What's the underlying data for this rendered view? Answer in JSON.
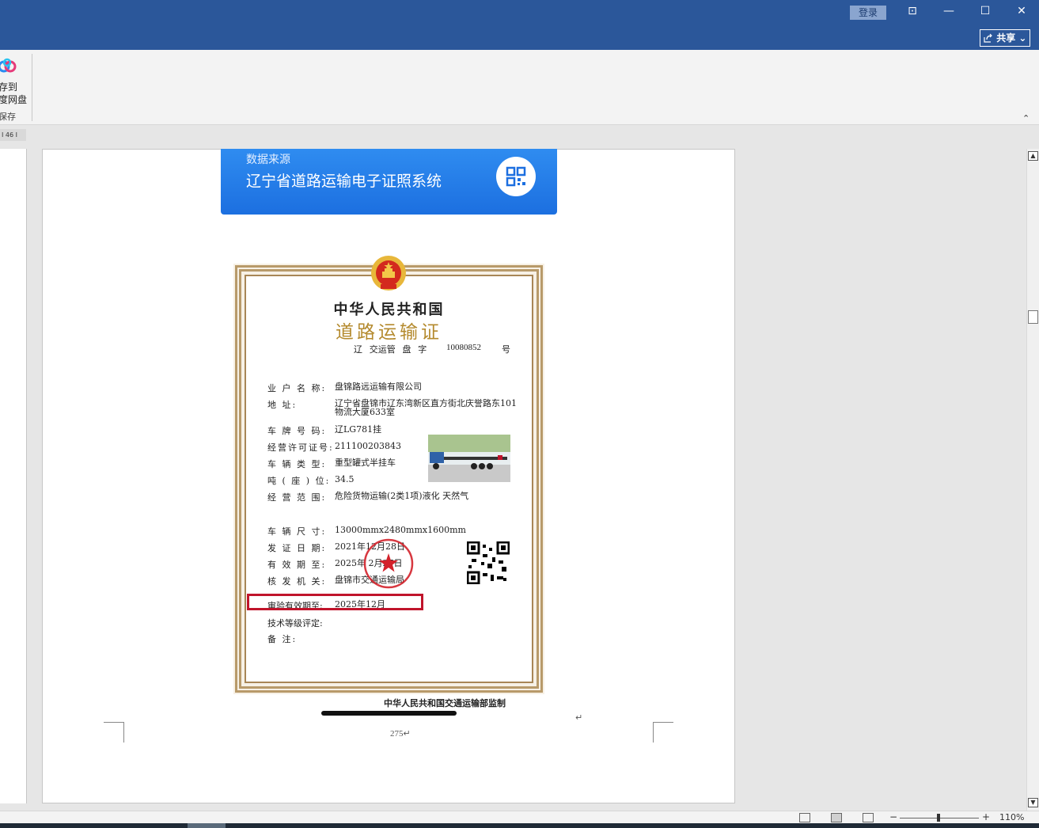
{
  "titlebar": {
    "login_label": "登录",
    "share_label": "共享",
    "share_chevron": "⌄",
    "controls": {
      "ribbon_display": "⊡",
      "minimize": "—",
      "maximize": "☐",
      "close": "✕"
    }
  },
  "ribbon": {
    "save_to_line1": "存到",
    "save_to_line2": "度网盘",
    "group_label": "保存",
    "collapse_glyph": "⌃"
  },
  "ruler": {
    "tab_text": "I 46 I"
  },
  "banner": {
    "subtitle": "数据来源",
    "title": "辽宁省道路运输电子证照系统"
  },
  "certificate": {
    "title1": "中华人民共和国",
    "title2": "道路运输证",
    "number_prefix": "辽  交运管 盘 字",
    "number": "10080852",
    "number_suffix": "号",
    "fields": [
      {
        "label": "业 户 名 称:",
        "value": "盘锦路远运输有限公司"
      },
      {
        "label": "地        址:",
        "value": "辽宁省盘锦市辽东湾新区直方街北庆誉路东101",
        "value2": "物流大厦633室"
      },
      {
        "label": "车 牌 号 码:",
        "value": "辽LG781挂"
      },
      {
        "label": "经营许可证号:",
        "value": "211100203843"
      },
      {
        "label": "车 辆 类 型:",
        "value": "重型罐式半挂车"
      },
      {
        "label": "吨 ( 座 ) 位:",
        "value": "34.5"
      },
      {
        "label": "经 营 范 围:",
        "value": "危险货物运输(2类1项)液化 天然气"
      },
      {
        "label": "车 辆 尺 寸:",
        "value": "13000mmx2480mmx1600mm"
      },
      {
        "label": "发 证 日 期:",
        "value": "2021年12月28日"
      },
      {
        "label": "有 效 期 至:",
        "value": "2025年 2月27日"
      },
      {
        "label": "核 发 机 关:",
        "value": "盘锦市交通运输局"
      },
      {
        "label": "审验有效期至:",
        "value": "2025年12月"
      },
      {
        "label": "技术等级评定:",
        "value": ""
      },
      {
        "label": "备        注:",
        "value": ""
      }
    ],
    "footer": "中华人民共和国交通运输部监制"
  },
  "page": {
    "page_number": "275↵",
    "paragraph_mark": "↵"
  },
  "statusbar": {
    "zoom_minus": "−",
    "zoom_plus": "+",
    "zoom_level": "110%",
    "zoom_fraction": 0.49
  },
  "colors": {
    "titlebar": "#2b579a",
    "banner": "#1c6fe0",
    "highlight": "#c0142b",
    "cert_gold": "#b48a2e"
  }
}
